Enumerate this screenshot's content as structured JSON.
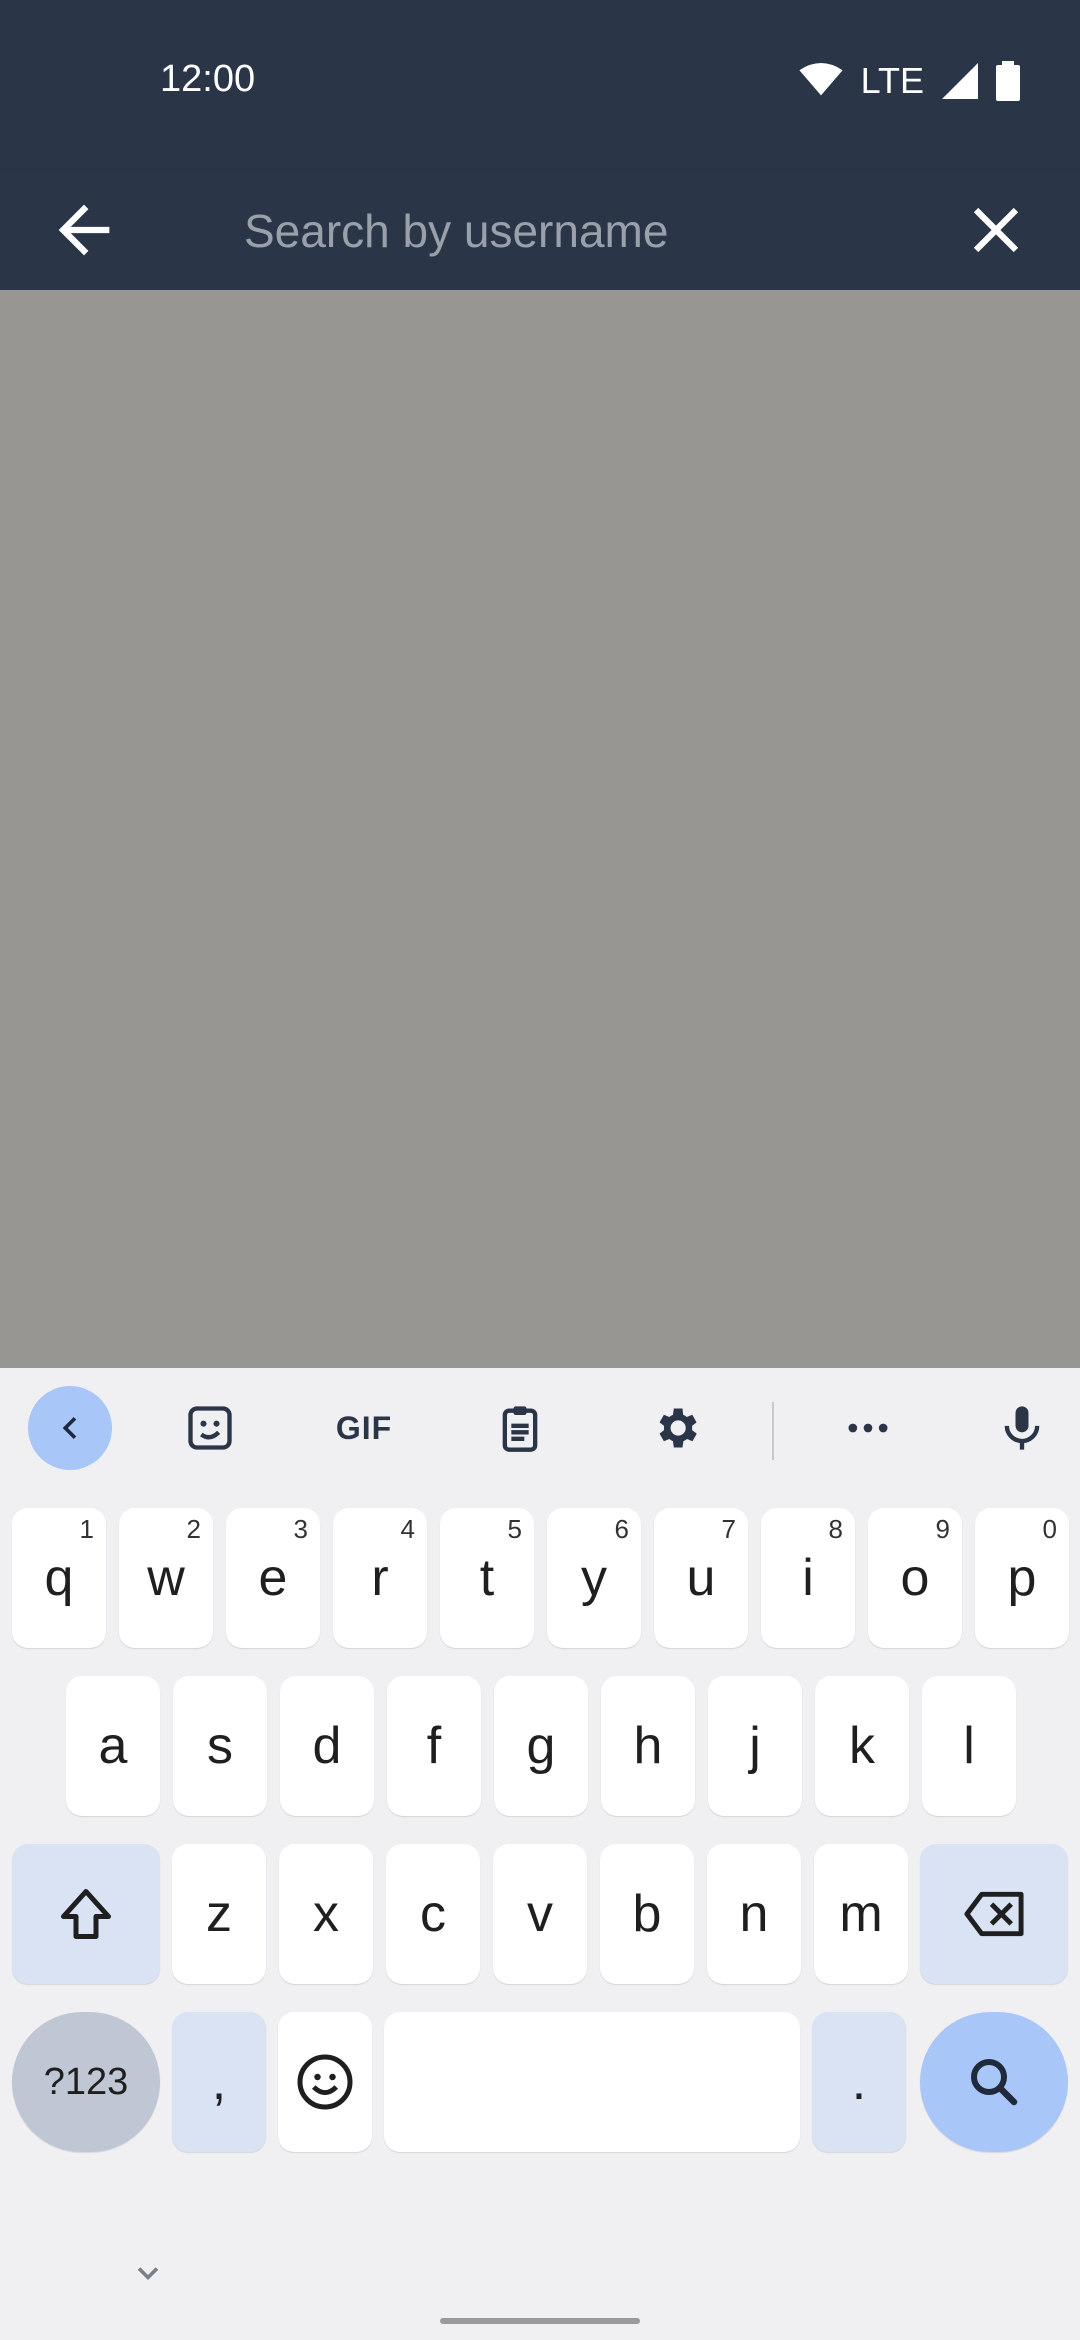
{
  "status": {
    "time": "12:00",
    "network": "LTE"
  },
  "search": {
    "placeholder": "Search by username",
    "value": ""
  },
  "icons": {
    "back": "arrow-left-icon",
    "clear": "close-icon",
    "wifi": "wifi-icon",
    "signal": "signal-icon",
    "battery": "battery-icon"
  },
  "keyboard": {
    "toolbar": {
      "gif_label": "GIF"
    },
    "row1": [
      {
        "k": "q",
        "h": "1"
      },
      {
        "k": "w",
        "h": "2"
      },
      {
        "k": "e",
        "h": "3"
      },
      {
        "k": "r",
        "h": "4"
      },
      {
        "k": "t",
        "h": "5"
      },
      {
        "k": "y",
        "h": "6"
      },
      {
        "k": "u",
        "h": "7"
      },
      {
        "k": "i",
        "h": "8"
      },
      {
        "k": "o",
        "h": "9"
      },
      {
        "k": "p",
        "h": "0"
      }
    ],
    "row2": [
      "a",
      "s",
      "d",
      "f",
      "g",
      "h",
      "j",
      "k",
      "l"
    ],
    "row3": [
      "z",
      "x",
      "c",
      "v",
      "b",
      "n",
      "m"
    ],
    "row4": {
      "symbols": "?123",
      "comma": ",",
      "period": "."
    }
  },
  "colors": {
    "appbar": "#2b3548",
    "scrim": "#979692",
    "keyboard_bg": "#f0f0f3",
    "accent": "#a8c6f8"
  }
}
